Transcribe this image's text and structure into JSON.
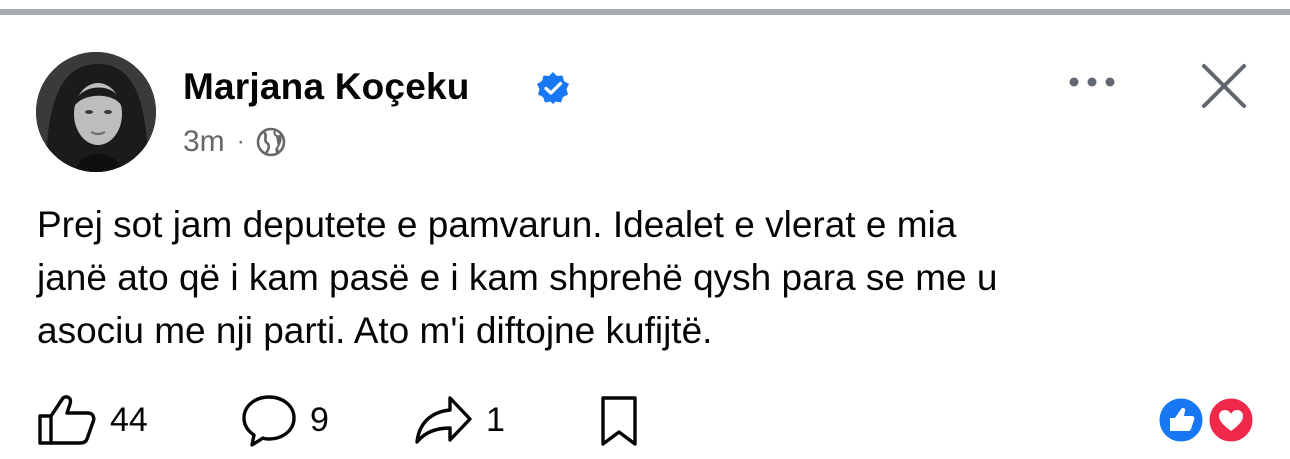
{
  "post": {
    "author": "Marjana Koçeku",
    "time": "3m",
    "separator": "·",
    "text_lines": [
      "Prej sot jam deputete e pamvarun. Idealet e vlerat e mia",
      "janë ato që i kam pasë e i kam shprehë qysh para se me u",
      "asociu me nji parti. Ato m'i diftojne kufijtë."
    ]
  },
  "actions": {
    "likes": "44",
    "comments": "9",
    "shares": "1"
  },
  "icons": {
    "verified": "verified-badge-icon",
    "audience": "globe-icon",
    "more": "more-options-icon",
    "close": "close-icon",
    "like": "thumbs-up-icon",
    "comment": "comment-bubble-icon",
    "share": "share-arrow-icon",
    "save": "bookmark-icon",
    "reactions": [
      "like-reaction-icon",
      "love-reaction-icon"
    ]
  },
  "colors": {
    "accent": "#1877f2",
    "love": "#f0284a",
    "meta_text": "#65676b"
  }
}
